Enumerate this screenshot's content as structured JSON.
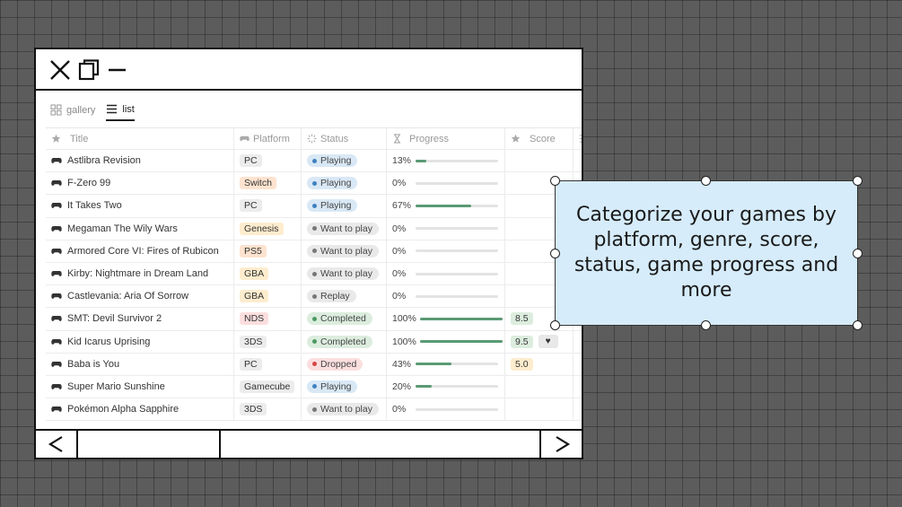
{
  "window": {
    "controls": [
      "close-icon",
      "restore-icon",
      "minimize-icon"
    ]
  },
  "views": [
    {
      "label": "gallery",
      "icon": "grid-icon",
      "active": false
    },
    {
      "label": "list",
      "icon": "list-icon",
      "active": true
    }
  ],
  "table": {
    "columns": [
      "Title",
      "Platform",
      "Status",
      "Progress",
      "Score"
    ],
    "rows": [
      {
        "title": "Astlibra Revision",
        "platform": "PC",
        "status": "Playing",
        "progress": "13%",
        "progress_value": 0.13,
        "score": ""
      },
      {
        "title": "F-Zero 99",
        "platform": "Switch",
        "status": "Playing",
        "progress": "0%",
        "progress_value": 0,
        "score": ""
      },
      {
        "title": "It Takes Two",
        "platform": "PC",
        "status": "Playing",
        "progress": "67%",
        "progress_value": 0.67,
        "score": ""
      },
      {
        "title": "Megaman The Wily Wars",
        "platform": "Genesis",
        "status": "Want to play",
        "progress": "0%",
        "progress_value": 0,
        "score": ""
      },
      {
        "title": "Armored Core VI: Fires of Rubicon",
        "platform": "PS5",
        "status": "Want to play",
        "progress": "0%",
        "progress_value": 0,
        "score": ""
      },
      {
        "title": "Kirby: Nightmare in Dream Land",
        "platform": "GBA",
        "status": "Want to play",
        "progress": "0%",
        "progress_value": 0,
        "score": ""
      },
      {
        "title": "Castlevania: Aria Of Sorrow",
        "platform": "GBA",
        "status": "Replay",
        "progress": "0%",
        "progress_value": 0,
        "score": ""
      },
      {
        "title": "SMT: Devil Survivor 2",
        "platform": "NDS",
        "status": "Completed",
        "progress": "100%",
        "progress_value": 1.0,
        "score": "8.5"
      },
      {
        "title": "Kid Icarus Uprising",
        "platform": "3DS",
        "status": "Completed",
        "progress": "100%",
        "progress_value": 1.0,
        "score": "9.5",
        "favorite": true
      },
      {
        "title": "Baba is You",
        "platform": "PC",
        "status": "Dropped",
        "progress": "43%",
        "progress_value": 0.43,
        "score": "5.0"
      },
      {
        "title": "Super Mario Sunshine",
        "platform": "Gamecube",
        "status": "Playing",
        "progress": "20%",
        "progress_value": 0.2,
        "score": ""
      },
      {
        "title": "Pokémon Alpha Sapphire",
        "platform": "3DS",
        "status": "Want to play",
        "progress": "0%",
        "progress_value": 0,
        "score": ""
      }
    ]
  },
  "colors": {
    "platform": {
      "PC": "#ececec",
      "Switch": "#fde3cf",
      "Genesis": "#fdeccd",
      "PS5": "#fde3cf",
      "GBA": "#fdeccd",
      "NDS": "#fcdede",
      "3DS": "#ececec",
      "Gamecube": "#ececec"
    },
    "status": {
      "Playing": {
        "bg": "#d9e8f5",
        "dot": "#3f82c0"
      },
      "Want to play": {
        "bg": "#e9e9e9",
        "dot": "#777777"
      },
      "Replay": {
        "bg": "#e9e9e9",
        "dot": "#777777"
      },
      "Completed": {
        "bg": "#dcedde",
        "dot": "#4b9a62"
      },
      "Dropped": {
        "bg": "#fbdfdf",
        "dot": "#d64545"
      }
    },
    "score": {
      "8.5": "#dcedde",
      "9.5": "#dcedde",
      "5.0": "#fdeccd"
    },
    "progress_fill": "#5a9a74",
    "callout_bg": "#d6ecfa"
  },
  "bottombar": {
    "prev": "<",
    "next": ">"
  },
  "callout": {
    "text": "Categorize your games by platform, genre, score, status, game progress and more"
  }
}
